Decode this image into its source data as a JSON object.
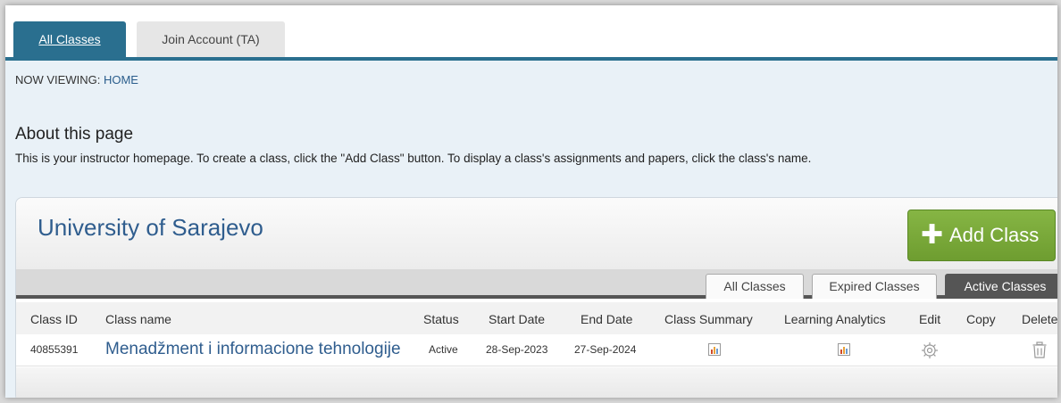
{
  "tabs": [
    {
      "label": "All Classes",
      "active": true
    },
    {
      "label": "Join Account (TA)",
      "active": false
    }
  ],
  "breadcrumb": {
    "prefix": "NOW VIEWING: ",
    "current": "HOME"
  },
  "about": {
    "title": "About this page",
    "text": "This is your instructor homepage. To create a class, click the \"Add Class\" button. To display a class's assignments and papers, click the class's name."
  },
  "institution": {
    "name": "University of Sarajevo"
  },
  "add_class_label": "Add Class",
  "filter_tabs": [
    {
      "label": "All Classes",
      "active": false
    },
    {
      "label": "Expired Classes",
      "active": false
    },
    {
      "label": "Active Classes",
      "active": true
    }
  ],
  "table": {
    "headers": [
      "Class ID",
      "Class name",
      "Status",
      "Start Date",
      "End Date",
      "Class Summary",
      "Learning Analytics",
      "Edit",
      "Copy",
      "Delete"
    ],
    "rows": [
      {
        "class_id": "40855391",
        "class_name": "Menadžment i informacione tehnologije",
        "status": "Active",
        "start_date": "28-Sep-2023",
        "end_date": "27-Sep-2024",
        "class_summary_icon": "bar-chart-icon",
        "learning_analytics_icon": "bar-chart-icon",
        "edit_icon": "gear-icon",
        "delete_icon": "trash-icon"
      }
    ]
  },
  "colors": {
    "tab_active": "#2a6f8f",
    "content_bg": "#e9f1f7",
    "link": "#2f5d8e",
    "add_button": "#7aad3a"
  }
}
